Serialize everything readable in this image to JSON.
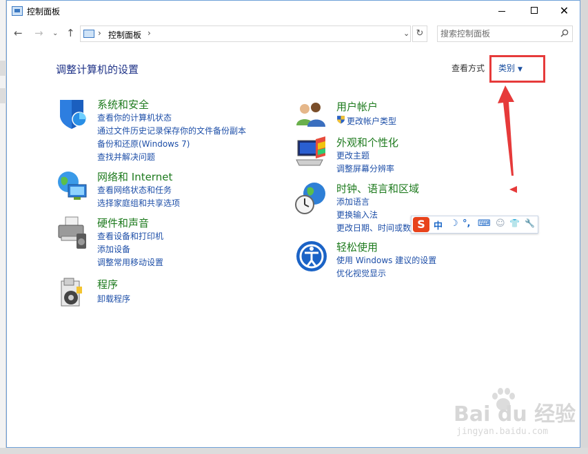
{
  "window": {
    "title": "控制面板",
    "controls": {
      "minimize": "—",
      "close": "✕"
    }
  },
  "nav": {
    "back": "←",
    "forward": "→",
    "dropdown": "⌄",
    "up": "↑",
    "address_separator": "›",
    "address_text": "控制面板",
    "address_dropdown": "⌄",
    "refresh": "↻",
    "search_placeholder": "搜索控制面板"
  },
  "main": {
    "heading": "调整计算机的设置",
    "view_by_label": "查看方式",
    "view_by_value": "类别",
    "view_by_caret": "▼"
  },
  "categories_left": [
    {
      "icon": "shield-icon",
      "title": "系统和安全",
      "links": [
        "查看你的计算机状态",
        "通过文件历史记录保存你的文件备份副本",
        "备份和还原(Windows 7)",
        "查找并解决问题"
      ]
    },
    {
      "icon": "network-globe-icon",
      "title": "网络和 Internet",
      "links": [
        "查看网络状态和任务",
        "选择家庭组和共享选项"
      ]
    },
    {
      "icon": "printer-icon",
      "title": "硬件和声音",
      "links": [
        "查看设备和打印机",
        "添加设备",
        "调整常用移动设置"
      ]
    },
    {
      "icon": "programs-icon",
      "title": "程序",
      "links": [
        "卸载程序"
      ]
    }
  ],
  "categories_right": [
    {
      "icon": "users-icon",
      "title": "用户帐户",
      "links": [
        "更改帐户类型"
      ]
    },
    {
      "icon": "appearance-icon",
      "title": "外观和个性化",
      "links": [
        "更改主题",
        "调整屏幕分辨率"
      ]
    },
    {
      "icon": "clock-globe-icon",
      "title": "时钟、语言和区域",
      "links": [
        "添加语言",
        "更换输入法",
        "更改日期、时间或数"
      ]
    },
    {
      "icon": "ease-of-access-icon",
      "title": "轻松使用",
      "links": [
        "使用 Windows 建议的设置",
        "优化视觉显示"
      ]
    }
  ],
  "ime": {
    "logo": "S",
    "mode": "中",
    "moon": "☽",
    "punct": "°,",
    "keyboard": "⌨",
    "user": "☺",
    "skin": "👕",
    "tools": "🔧"
  },
  "watermark": {
    "main": "Bai du 经验",
    "sub": "jingyan.baidu.com"
  },
  "colors": {
    "accent_red": "#e63a3a",
    "category_green": "#1d7a1d",
    "link_blue": "#1e4fa8",
    "heading_blue": "#1e3287"
  }
}
